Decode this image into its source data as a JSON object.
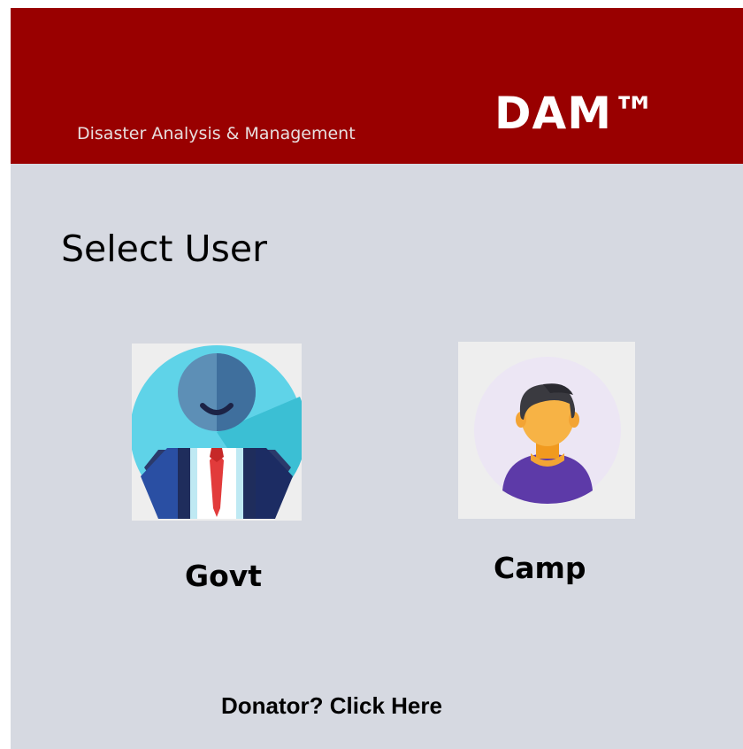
{
  "header": {
    "subtitle": "Disaster Analysis & Management",
    "brand": "DAM™",
    "background_color": "#990000"
  },
  "main": {
    "title": "Select User",
    "background_color": "#d6d9e1",
    "users": [
      {
        "label": "Govt",
        "icon": "government-official-avatar-icon"
      },
      {
        "label": "Camp",
        "icon": "camp-user-avatar-icon"
      }
    ]
  },
  "footer": {
    "donator_link": "Donator? Click Here"
  }
}
